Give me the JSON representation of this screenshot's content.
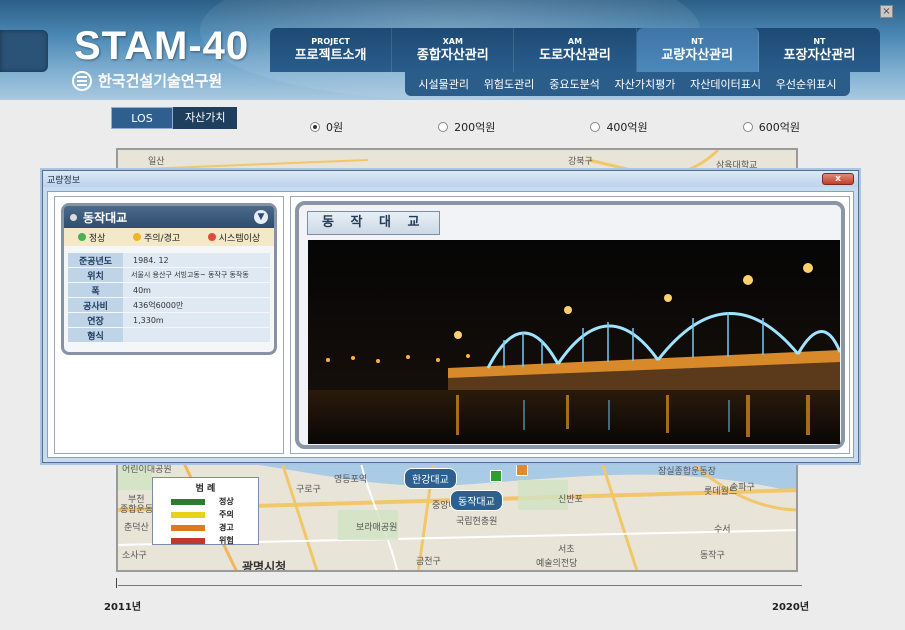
{
  "header": {
    "logo": "STAM-40",
    "org": "한국건설기술연구원",
    "close_icon": "close-icon",
    "nav": [
      {
        "sup": "PROJECT",
        "label": "프로젝트소개"
      },
      {
        "sup": "XAM",
        "label": "종합자산관리"
      },
      {
        "sup": "AM",
        "label": "도로자산관리"
      },
      {
        "sup": "NT",
        "label": "교량자산관리"
      },
      {
        "sup": "NT",
        "label": "포장자산관리"
      }
    ],
    "subnav": [
      "시설물관리",
      "위험도관리",
      "중요도분석",
      "자산가치평가",
      "자산데이터표시",
      "우선순위표시"
    ]
  },
  "toggle": {
    "los": "LOS",
    "asset_value": "자산가치"
  },
  "radios": [
    {
      "label": "0원",
      "checked": true
    },
    {
      "label": "200억원",
      "checked": false
    },
    {
      "label": "400억원",
      "checked": false
    },
    {
      "label": "600억원",
      "checked": false
    }
  ],
  "map": {
    "labels": [
      "일산",
      "강북구",
      "삼육대학교",
      "어린이대공원",
      "부천",
      "종합운동장",
      "춘덕산",
      "소사구",
      "광명시청",
      "구로구",
      "영등포역",
      "보라매공원",
      "금천구",
      "국립현충원",
      "신반포",
      "서초",
      "예술의전당",
      "수서",
      "송파구",
      "롯데월드",
      "잠실종합운동장",
      "중앙대",
      "동작구"
    ],
    "bridges": [
      {
        "name": "한강대교"
      },
      {
        "name": "동작대교"
      }
    ]
  },
  "legend": {
    "title": "범 례",
    "items": [
      {
        "label": "정상",
        "color": "#2e7d2e"
      },
      {
        "label": "주의",
        "color": "#e3d41a"
      },
      {
        "label": "경고",
        "color": "#e07a1e"
      },
      {
        "label": "위험",
        "color": "#c0392b"
      }
    ]
  },
  "timeline": {
    "start": "2011년",
    "end": "2020년"
  },
  "popup": {
    "title": "교량정보",
    "close": "x",
    "bridge_name": "동작대교",
    "status": [
      {
        "label": "정상",
        "color": "#4caf50"
      },
      {
        "label": "주의/경고",
        "color": "#f0b429"
      },
      {
        "label": "시스템이상",
        "color": "#e04b3a"
      }
    ],
    "fields": [
      {
        "key": "준공년도",
        "value": "1984. 12"
      },
      {
        "key": "위치",
        "value": "서울시 용산구 서빙고동~ 동작구 동작동"
      },
      {
        "key": "폭",
        "value": "40m"
      },
      {
        "key": "공사비",
        "value": "436억6000만"
      },
      {
        "key": "연장",
        "value": "1,330m"
      },
      {
        "key": "형식",
        "value": ""
      }
    ],
    "photo_title": "동 작 대 교"
  }
}
